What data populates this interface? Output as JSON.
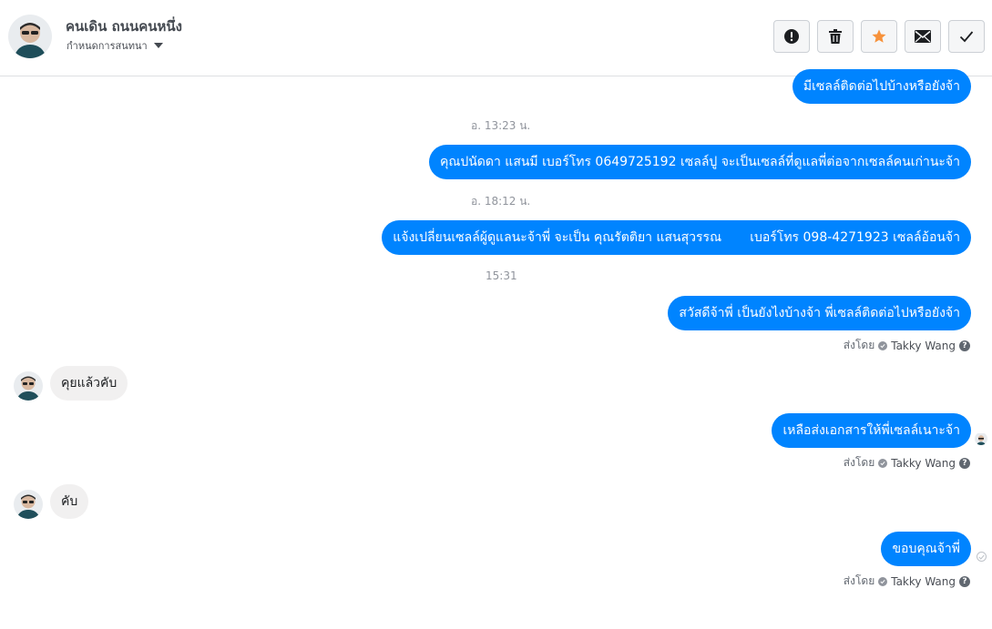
{
  "header": {
    "contact_name": "คนเดิน ถนนคนหนึ่ง",
    "assign_label": "กำหนดการสนทนา",
    "actions": [
      {
        "name": "mark-spam-button",
        "icon": "alert-circle-icon"
      },
      {
        "name": "delete-button",
        "icon": "trash-icon"
      },
      {
        "name": "star-button",
        "icon": "star-icon"
      },
      {
        "name": "mark-unread-button",
        "icon": "envelope-icon"
      },
      {
        "name": "mark-done-button",
        "icon": "checkmark-icon"
      }
    ]
  },
  "colors": {
    "outgoing_bubble": "#0084ff",
    "incoming_bubble": "#f1f0f0",
    "star": "#f7923b"
  },
  "messages": {
    "m1": "มีเซลล์ติดต่อไปบ้างหรือยังจ้า",
    "t1": "อ. 13:23 น.",
    "m2": "คุณปนัดดา แสนมี เบอร์โทร 0649725192 เซลล์ปู จะเป็นเซลล์ที่ดูแลพี่ต่อจากเซลล์คนเก่านะจ้า",
    "t2": "อ. 18:12 น.",
    "m3": "แจ้งเปลี่ยนเซลล์ผู้ดูแลนะจ้าพี่ จะเป็น คุณรัตติยา แสนสุวรรณ       เบอร์โทร 098-4271923 เซลล์อ้อนจ้า",
    "t3": "15:31",
    "m4": "สวัสดีจ้าพี่ เป็นยังไงบ้างจ้า พี่เซลล์ติดต่อไปหรือยังจ้า",
    "m5": "คุยแล้วคับ",
    "m6": "เหลือส่งเอกสารให้พี่เซลล์เนาะจ้า",
    "m7": "คับ",
    "m8": "ขอบคุณจ้าพี่"
  },
  "sent_by": {
    "label": "ส่งโดย",
    "agent": "Takky Wang",
    "help": "?"
  }
}
